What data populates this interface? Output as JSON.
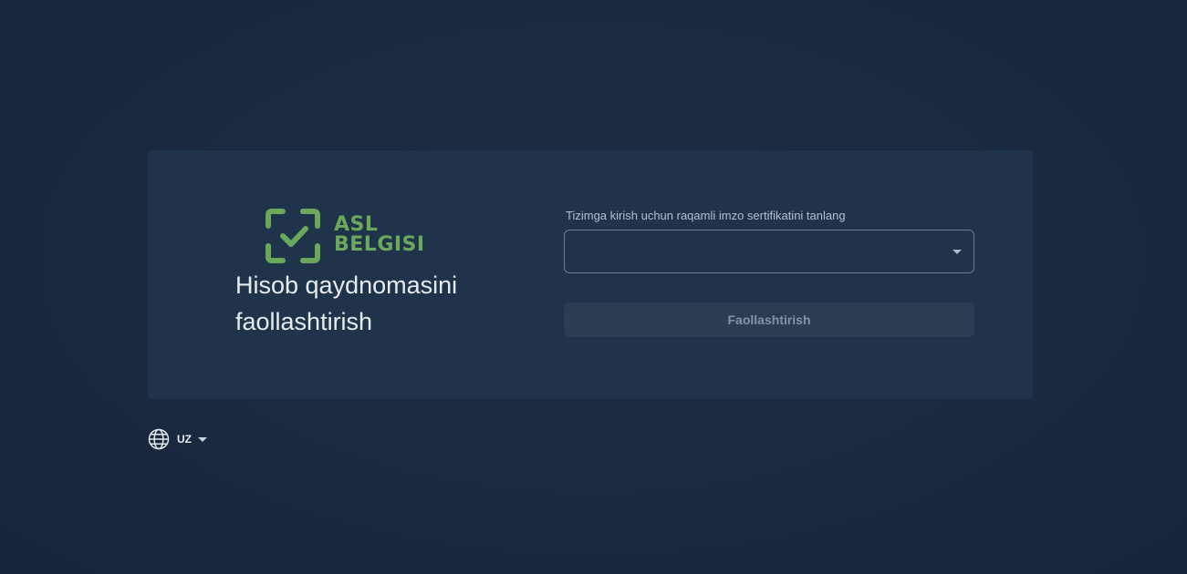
{
  "brand": {
    "line1": "ASL",
    "line2": "BELGISI",
    "color": "#6aa85c"
  },
  "page": {
    "title": "Hisob qaydnomasini faollashtirish"
  },
  "form": {
    "certificate_label": "Tizimga kirish uchun raqamli imzo sertifikatini tanlang",
    "certificate_value": "",
    "submit_label": "Faollashtirish",
    "submit_enabled": false
  },
  "language": {
    "current": "UZ",
    "icon": "globe-icon"
  },
  "colors": {
    "background": "#1a2a40",
    "card": "#1f344b",
    "accent": "#6aa85c"
  }
}
